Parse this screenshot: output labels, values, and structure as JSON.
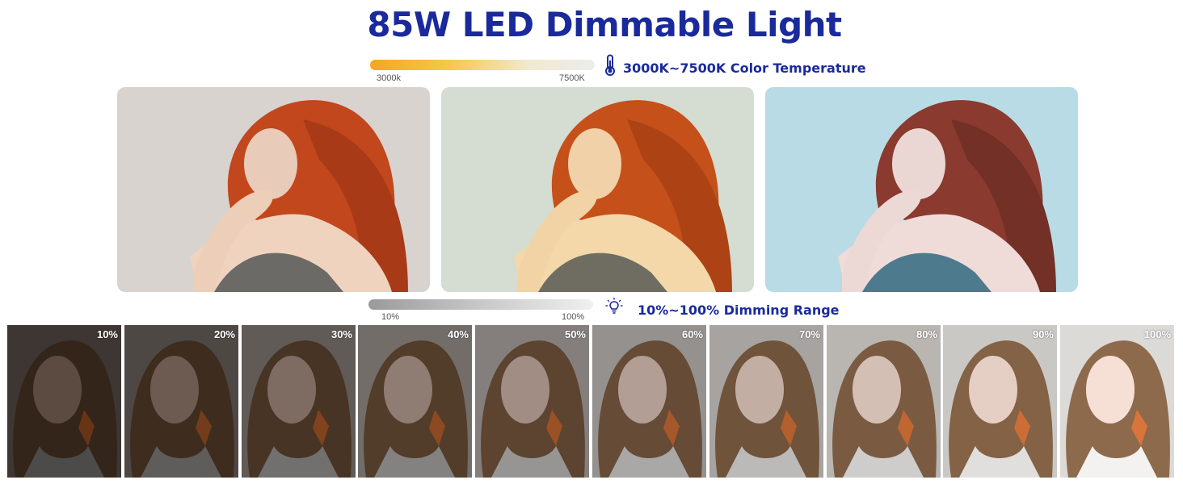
{
  "title": "85W LED Dimmable Light",
  "temperature": {
    "label": "3000K~7500K Color Temperature",
    "min_label": "3000k",
    "max_label": "7500K",
    "icon": "thermometer-icon",
    "icon_color": "#1a2a9c"
  },
  "dimming": {
    "label": "10%~100% Dimming Range",
    "min_label": "10%",
    "max_label": "100%",
    "icon": "lightbulb-icon"
  },
  "panels": [
    {
      "name": "warm",
      "bg": "#d8d3cf"
    },
    {
      "name": "neutral",
      "bg": "#d5dcd1"
    },
    {
      "name": "cool",
      "bg": "#b9dbe5"
    }
  ],
  "brightness_steps": [
    {
      "label": "10%",
      "level": 0.1
    },
    {
      "label": "20%",
      "level": 0.2
    },
    {
      "label": "30%",
      "level": 0.3
    },
    {
      "label": "40%",
      "level": 0.4
    },
    {
      "label": "50%",
      "level": 0.5
    },
    {
      "label": "60%",
      "level": 0.6
    },
    {
      "label": "70%",
      "level": 0.7
    },
    {
      "label": "80%",
      "level": 0.8
    },
    {
      "label": "90%",
      "level": 0.9
    },
    {
      "label": "100%",
      "level": 1.0
    }
  ],
  "colors": {
    "title": "#1a2a9c",
    "warm_hair": "#c2471d",
    "cool_hair": "#8a3a2e"
  }
}
